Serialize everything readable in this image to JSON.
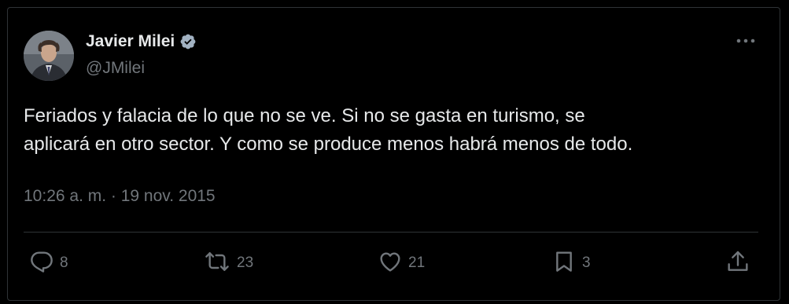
{
  "author": {
    "display_name": "Javier Milei",
    "handle": "@JMilei",
    "verified_color": "#a2b2c2"
  },
  "tweet": {
    "lines": [
      "Feriados y falacia de lo que no se ve. Si no se gasta en turismo, se",
      "aplicará en otro sector. Y como se produce menos habrá menos de todo."
    ],
    "timestamp": "10:26 a. m. · 19 nov. 2015"
  },
  "actions": {
    "replies": "8",
    "reposts": "23",
    "likes": "21",
    "bookmarks": "3"
  },
  "colors": {
    "background": "#000000",
    "text": "#e7e9ea",
    "muted": "#71767b",
    "divider": "#2f3336"
  }
}
